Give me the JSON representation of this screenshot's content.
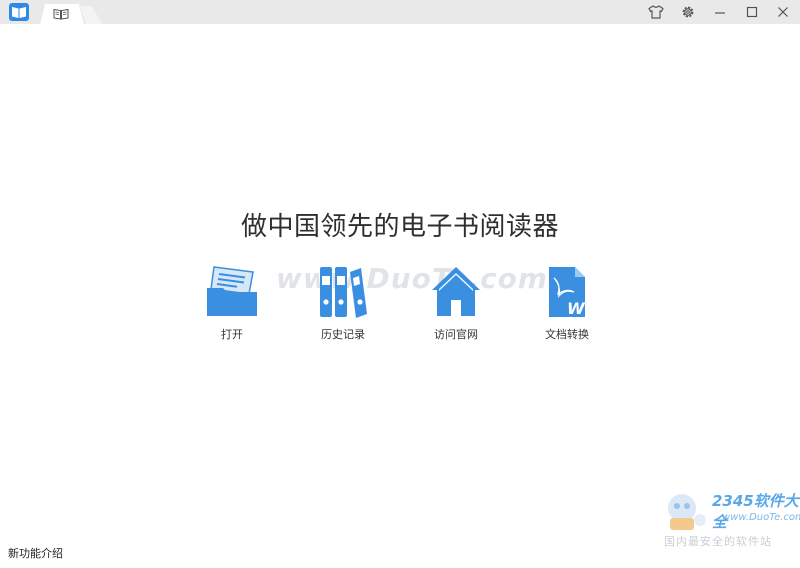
{
  "window": {
    "tab_icon": "open-book-icon",
    "controls": [
      "shirt-icon",
      "gear-icon",
      "minimize-icon",
      "maximize-icon",
      "close-icon"
    ]
  },
  "main": {
    "slogan": "做中国领先的电子书阅读器",
    "actions": [
      {
        "label": "打开",
        "icon": "folder-icon"
      },
      {
        "label": "历史记录",
        "icon": "binders-icon"
      },
      {
        "label": "访问官网",
        "icon": "home-icon"
      },
      {
        "label": "文档转换",
        "icon": "pdf-to-word-icon"
      }
    ]
  },
  "footer": {
    "features_link": "新功能介绍"
  },
  "watermarks": {
    "duote": "www.DuoTe.com",
    "badge_brand": "2345软件大全",
    "badge_site": "www.DuoTe.com",
    "badge_sub": "国内最安全的软件站"
  },
  "colors": {
    "accent": "#3a8fe0",
    "titlebar": "#e9e9e9"
  }
}
